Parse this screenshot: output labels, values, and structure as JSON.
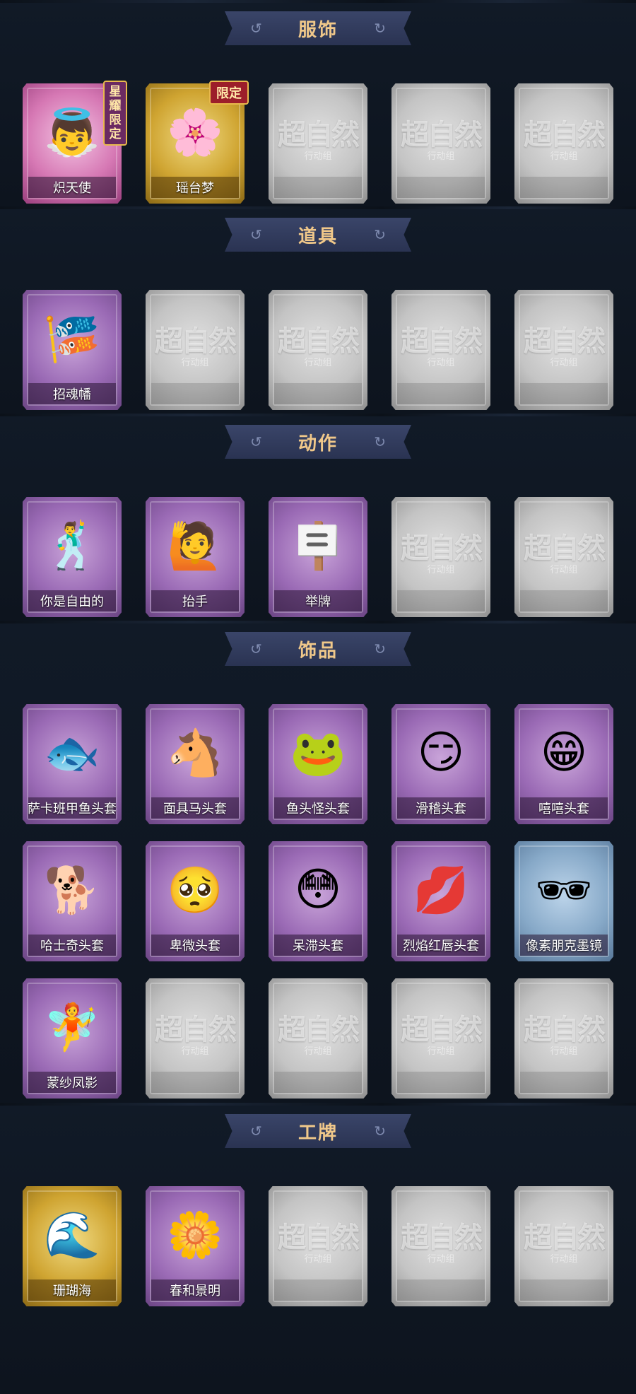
{
  "placeholder": {
    "main": "超自然",
    "sub": "行动组"
  },
  "sections": [
    {
      "title": "服饰",
      "rows": [
        [
          {
            "label": "炽天使",
            "style": "pink",
            "icon": "angel-portrait-icon",
            "glyph": "👼",
            "badge_vertical": "星耀限定"
          },
          {
            "label": "瑶台梦",
            "style": "gold",
            "icon": "dream-portrait-icon",
            "glyph": "🌸",
            "badge": "限定"
          },
          {
            "style": "empty"
          },
          {
            "style": "empty"
          },
          {
            "style": "empty"
          }
        ]
      ]
    },
    {
      "title": "道具",
      "rows": [
        [
          {
            "label": "招魂幡",
            "style": "purple",
            "icon": "banner-icon",
            "glyph": "🎏"
          },
          {
            "style": "empty"
          },
          {
            "style": "empty"
          },
          {
            "style": "empty"
          },
          {
            "style": "empty"
          }
        ]
      ]
    },
    {
      "title": "动作",
      "rows": [
        [
          {
            "label": "你是自由的",
            "style": "purple",
            "icon": "free-pose-icon",
            "glyph": "🕺"
          },
          {
            "label": "抬手",
            "style": "purple",
            "icon": "raise-hand-icon",
            "glyph": "🙋"
          },
          {
            "label": "举牌",
            "style": "purple",
            "icon": "sign-hold-icon",
            "glyph": "🪧"
          },
          {
            "style": "empty"
          },
          {
            "style": "empty"
          }
        ]
      ]
    },
    {
      "title": "饰品",
      "rows": [
        [
          {
            "label": "萨卡班甲鱼头套",
            "style": "purple",
            "icon": "fish-mask-icon",
            "glyph": "🐟"
          },
          {
            "label": "面具马头套",
            "style": "purple",
            "icon": "horse-mask-icon",
            "glyph": "🐴"
          },
          {
            "label": "鱼头怪头套",
            "style": "purple",
            "icon": "fish-monster-mask-icon",
            "glyph": "🐸"
          },
          {
            "label": "滑稽头套",
            "style": "purple",
            "icon": "funny-face-icon",
            "glyph": "😏"
          },
          {
            "label": "嘻嘻头套",
            "style": "purple",
            "icon": "grin-face-icon",
            "glyph": "😁"
          }
        ],
        [
          {
            "label": "哈士奇头套",
            "style": "purple",
            "icon": "husky-mask-icon",
            "glyph": "🐕"
          },
          {
            "label": "卑微头套",
            "style": "purple",
            "icon": "humble-face-icon",
            "glyph": "🥺"
          },
          {
            "label": "呆滞头套",
            "style": "purple",
            "icon": "dazed-face-icon",
            "glyph": "😳"
          },
          {
            "label": "烈焰红唇头套",
            "style": "purple",
            "icon": "red-lips-mask-icon",
            "glyph": "💋"
          },
          {
            "label": "像素朋克墨镜",
            "style": "blue",
            "icon": "pixel-sunglasses-icon",
            "glyph": "🕶"
          }
        ],
        [
          {
            "label": "蒙纱凤影",
            "style": "purple",
            "icon": "phoenix-pendant-icon",
            "glyph": "🧚"
          },
          {
            "style": "empty"
          },
          {
            "style": "empty"
          },
          {
            "style": "empty"
          },
          {
            "style": "empty"
          }
        ]
      ]
    },
    {
      "title": "工牌",
      "rows": [
        [
          {
            "label": "珊瑚海",
            "style": "gold",
            "icon": "coral-sea-badge-icon",
            "glyph": "🌊"
          },
          {
            "label": "春和景明",
            "style": "purple",
            "icon": "spring-badge-icon",
            "glyph": "🌼"
          },
          {
            "style": "empty"
          },
          {
            "style": "empty"
          },
          {
            "style": "empty"
          }
        ]
      ]
    }
  ]
}
